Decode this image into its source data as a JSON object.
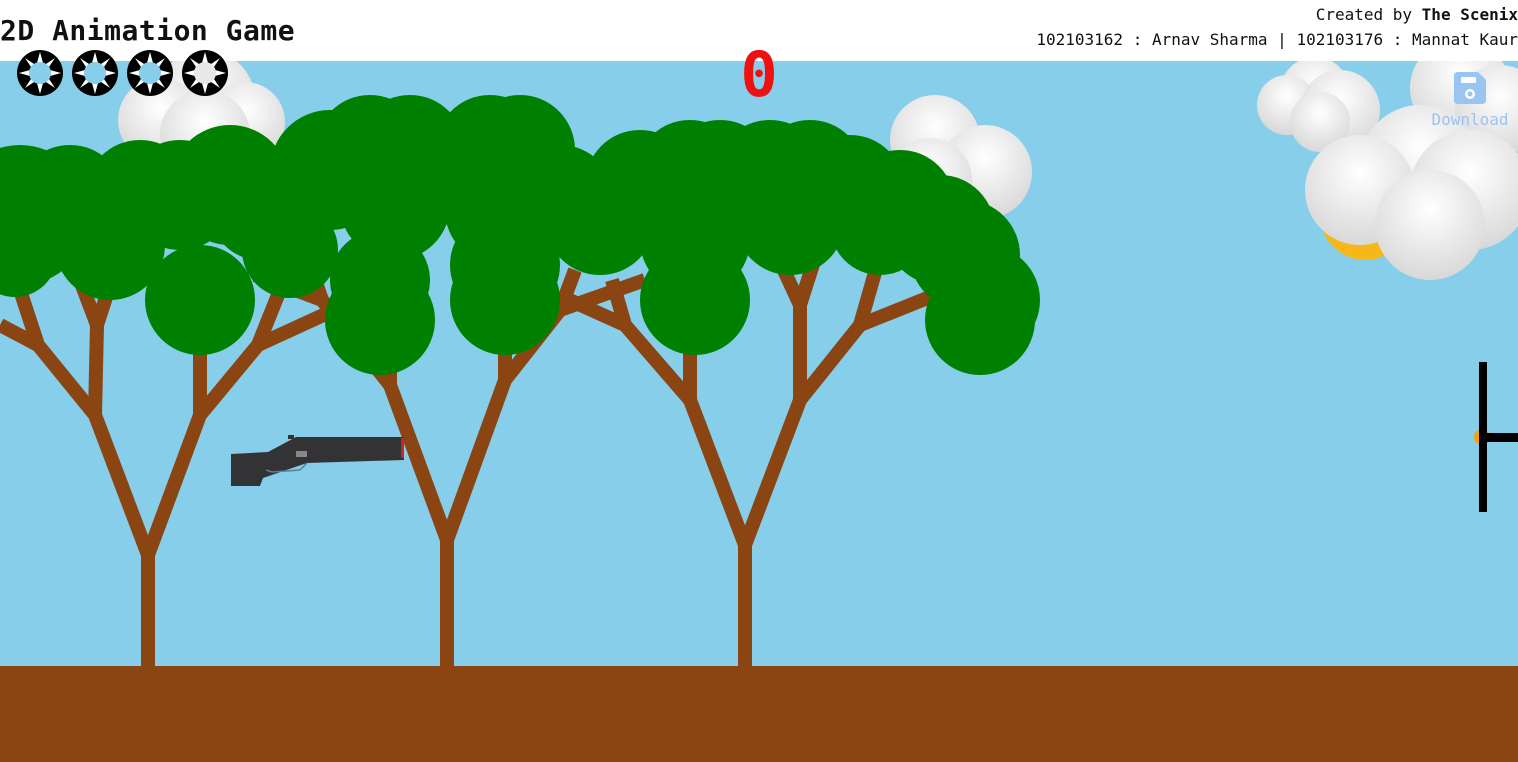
{
  "header": {
    "title": "2D Animation Game",
    "credits_prefix": "Created by ",
    "credits_team": "The Scenix",
    "credits_members": "102103162 : Arnav Sharma | 102103176 : Mannat Kaur"
  },
  "hud": {
    "score": "0",
    "lives": [
      {
        "icon": "sun-life-icon",
        "state": "active"
      },
      {
        "icon": "sun-life-icon",
        "state": "active"
      },
      {
        "icon": "sun-life-icon",
        "state": "active"
      },
      {
        "icon": "sun-life-icon",
        "state": "spent"
      }
    ],
    "download_label": "Download",
    "download_icon": "floppy-disk-icon"
  },
  "scene": {
    "sky_color": "#87ceeb",
    "ground_color": "#8b4513",
    "trunk_color": "#8b4513",
    "foliage_color": "#008000",
    "score_color": "#ee1111",
    "weapon": "shotgun-icon",
    "target": "crosshair-target"
  }
}
